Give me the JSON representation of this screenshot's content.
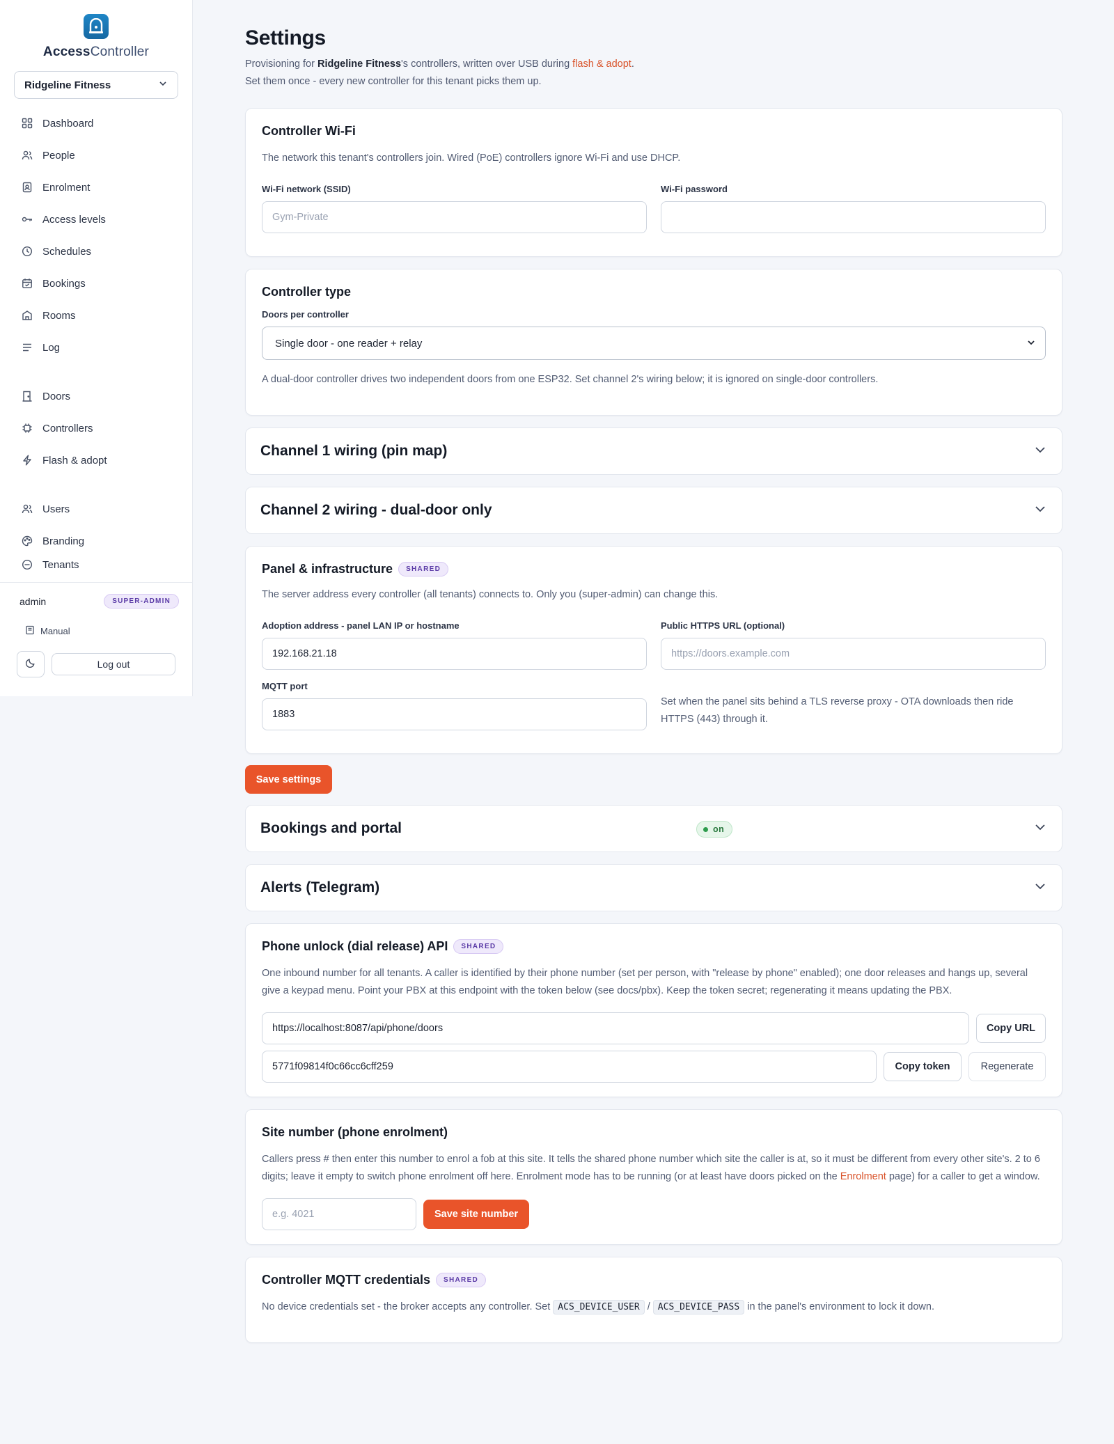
{
  "brand": {
    "name_bold": "Access",
    "name_light": "Controller",
    "logo_icon": "door-lock-icon"
  },
  "tenant_selector": {
    "value": "Ridgeline Fitness"
  },
  "nav": {
    "primary": [
      {
        "label": "Dashboard",
        "icon": "grid-icon"
      },
      {
        "label": "People",
        "icon": "people-icon"
      },
      {
        "label": "Enrolment",
        "icon": "badge-icon"
      },
      {
        "label": "Access levels",
        "icon": "key-icon"
      },
      {
        "label": "Schedules",
        "icon": "clock-icon"
      },
      {
        "label": "Bookings",
        "icon": "calendar-icon"
      },
      {
        "label": "Rooms",
        "icon": "room-icon"
      },
      {
        "label": "Log",
        "icon": "list-icon"
      }
    ],
    "hardware": [
      {
        "label": "Doors",
        "icon": "door-icon"
      },
      {
        "label": "Controllers",
        "icon": "chip-icon"
      },
      {
        "label": "Flash & adopt",
        "icon": "bolt-icon"
      }
    ],
    "admin": [
      {
        "label": "Users",
        "icon": "users-icon"
      },
      {
        "label": "Branding",
        "icon": "palette-icon"
      },
      {
        "label": "Tenants",
        "icon": "tenants-icon"
      }
    ]
  },
  "sidebar_footer": {
    "user": "admin",
    "role": "SUPER-ADMIN",
    "manual": "Manual",
    "logout": "Log out"
  },
  "page": {
    "title": "Settings",
    "desc_1": "Provisioning for ",
    "desc_tenant": "Ridgeline Fitness",
    "desc_2": "'s controllers, written over USB during ",
    "desc_link": "flash & adopt",
    "desc_3": ". Set them once - every new controller for this tenant picks them up."
  },
  "wifi": {
    "title": "Controller Wi-Fi",
    "desc": "The network this tenant's controllers join. Wired (PoE) controllers ignore Wi-Fi and use DHCP.",
    "ssid_label": "Wi-Fi network (SSID)",
    "ssid_placeholder": "Gym-Private",
    "password_label": "Wi-Fi password",
    "password_value": ""
  },
  "controller_type": {
    "title": "Controller type",
    "doors_label": "Doors per controller",
    "doors_value": "Single door - one reader + relay",
    "desc": "A dual-door controller drives two independent doors from one ESP32. Set channel 2's wiring below; it is ignored on single-door controllers."
  },
  "channel1": {
    "title": "Channel 1 wiring (pin map)"
  },
  "channel2": {
    "title": "Channel 2 wiring - dual-door only"
  },
  "panel": {
    "title": "Panel & infrastructure",
    "badge": "SHARED",
    "desc": "The server address every controller (all tenants) connects to. Only you (super-admin) can change this.",
    "adoption_label": "Adoption address - panel LAN IP or hostname",
    "adoption_value": "192.168.21.18",
    "https_label": "Public HTTPS URL (optional)",
    "https_placeholder": "https://doors.example.com",
    "mqtt_label": "MQTT port",
    "mqtt_value": "1883",
    "https_help": "Set when the panel sits behind a TLS reverse proxy - OTA downloads then ride HTTPS (443) through it."
  },
  "save_settings": "Save settings",
  "bookings": {
    "title": "Bookings and portal",
    "status": "on"
  },
  "alerts": {
    "title": "Alerts (Telegram)"
  },
  "phone_api": {
    "title": "Phone unlock (dial release) API",
    "badge": "SHARED",
    "desc": "One inbound number for all tenants. A caller is identified by their phone number (set per person, with \"release by phone\" enabled); one door releases and hangs up, several give a keypad menu. Point your PBX at this endpoint with the token below (see docs/pbx). Keep the token secret; regenerating it means updating the PBX.",
    "url": "https://localhost:8087/api/phone/doors",
    "copy_url": "Copy URL",
    "token": "5771f09814f0c66cc6cff259",
    "copy_token": "Copy token",
    "regenerate": "Regenerate"
  },
  "site_number": {
    "title": "Site number (phone enrolment)",
    "desc_1": "Callers press # then enter this number to enrol a fob at this site. It tells the shared phone number which site the caller is at, so it must be different from every other site's. 2 to 6 digits; leave it empty to switch phone enrolment off here. Enrolment mode has to be running (or at least have doors picked on the ",
    "desc_link": "Enrolment",
    "desc_2": " page) for a caller to get a window.",
    "placeholder": "e.g. 4021",
    "save": "Save site number"
  },
  "mqtt_creds": {
    "title": "Controller MQTT credentials",
    "badge": "SHARED",
    "desc_1": "No device credentials set - the broker accepts any controller. Set ",
    "code_user": "ACS_DEVICE_USER",
    "sep": "/",
    "code_pass": "ACS_DEVICE_PASS",
    "desc_2": " in the panel's environment to lock it down."
  },
  "colors": {
    "accent": "#e9542a",
    "brand": "#1f86c6",
    "badge_purple": "#5a3aa6",
    "on_green": "#2a7a3f"
  }
}
